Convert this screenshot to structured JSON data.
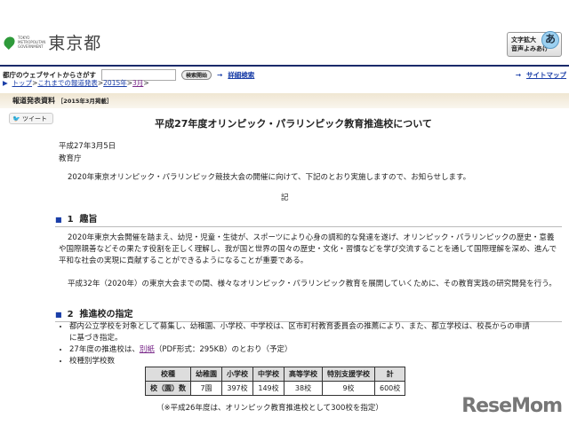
{
  "header": {
    "logo_small": [
      "TOKYO",
      "METROPOLITAN",
      "GOVERNMENT"
    ],
    "logo_text": "東京都",
    "access_line1": "文字拡大",
    "access_line2": "音声よみあげ",
    "access_icon": "あ"
  },
  "search": {
    "label": "都庁のウェブサイトからさがす",
    "value": "",
    "button": "検索開始",
    "advanced": "詳細検索",
    "sitemap": "サイトマップ"
  },
  "breadcrumb": [
    "トップ",
    "これまでの報道発表",
    "2015年",
    "3月"
  ],
  "section_bar": {
    "title": "報道発表資料",
    "date": "［2015年3月掲載］"
  },
  "tweet": "ツイート",
  "page_title": "平成27年度オリンピック・パラリンピック教育推進校について",
  "date": "平成27年3月5日",
  "org": "教育庁",
  "intro": "2020年東京オリンピック・パラリンピック競技大会の開催に向けて、下記のとおり実施しますので、お知らせします。",
  "ki": "記",
  "sec1": {
    "num": "1",
    "title": "趣旨",
    "p1": "2020年東京大会開催を踏まえ、幼児・児童・生徒が、スポーツにより心身の調和的な発達を遂げ、オリンピック・パラリンピックの歴史・意義や国際親善などその果たす役割を正しく理解し、我が国と世界の国々の歴史・文化・習慣などを学び交流することを通して国際理解を深め、進んで平和な社会の実現に貢献することができるようになることが重要である。",
    "p2": "平成32年（2020年）の東京大会までの間、様々なオリンピック・パラリンピック教育を展開していくために、その教育実践の研究開発を行う。"
  },
  "sec2": {
    "num": "2",
    "title": "推進校の指定",
    "b1": "都内公立学校を対象として募集し、幼稚園、小学校、中学校は、区市町村教育委員会の推薦により、また、都立学校は、校長からの申請に基づき指定。",
    "b2_pre": "27年度の推進校は、",
    "b2_link": "別紙",
    "b2_post": "（PDF形式：295KB）のとおり（予定）",
    "b3": "校種別学校数",
    "table": {
      "headers": [
        "校種",
        "幼稚園",
        "小学校",
        "中学校",
        "高等学校",
        "特別支援学校",
        "計"
      ],
      "row": [
        "校（園）数",
        "7園",
        "397校",
        "149校",
        "38校",
        "9校",
        "600校"
      ]
    },
    "note": "（※平成26年度は、オリンピック教育推進校として300校を指定）"
  },
  "watermark": "ReseMom"
}
